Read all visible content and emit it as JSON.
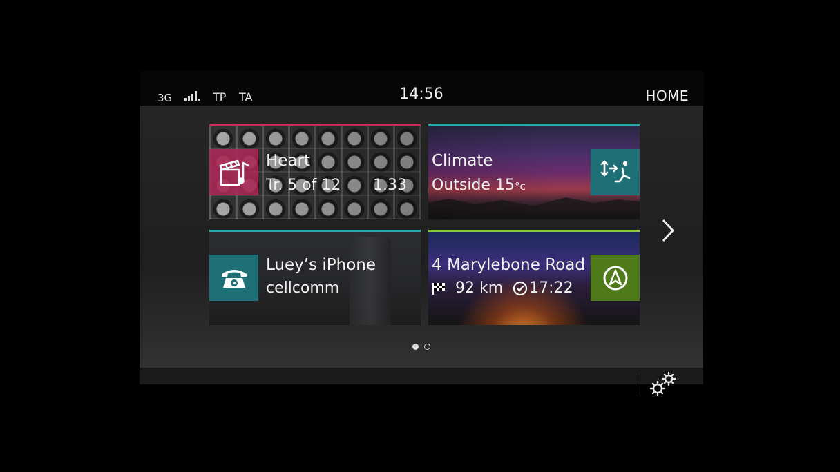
{
  "status_bar": {
    "network": "3G",
    "tp": "TP",
    "ta": "TA",
    "time": "14:56",
    "home": "HOME"
  },
  "tiles": {
    "media": {
      "icon": "media-clapper-note-icon",
      "title": "Heart",
      "track": "Tr. 5 of 12",
      "duration": "1.33",
      "accent": "#d1275a"
    },
    "climate": {
      "icon": "climate-airflow-icon",
      "title": "Climate",
      "outside_label": "Outside 15",
      "unit": "°c",
      "accent": "#2aa7a8"
    },
    "phone": {
      "icon": "phone-icon",
      "title": "Luey’s iPhone",
      "carrier": "cellcomm",
      "accent": "#2aa7a8"
    },
    "navigation": {
      "icon": "navigation-arrow-icon",
      "title": "4 Marylebone Road",
      "distance": "92 km",
      "eta": "17:22",
      "accent": "#8cc63e"
    }
  },
  "pager": {
    "pages": 2,
    "current": 1
  },
  "icons": {
    "next": "chevron-right-icon",
    "settings": "gear-icon",
    "signal": "signal-strength-icon",
    "flag": "checkered-flag-icon",
    "clock": "clock-icon"
  }
}
